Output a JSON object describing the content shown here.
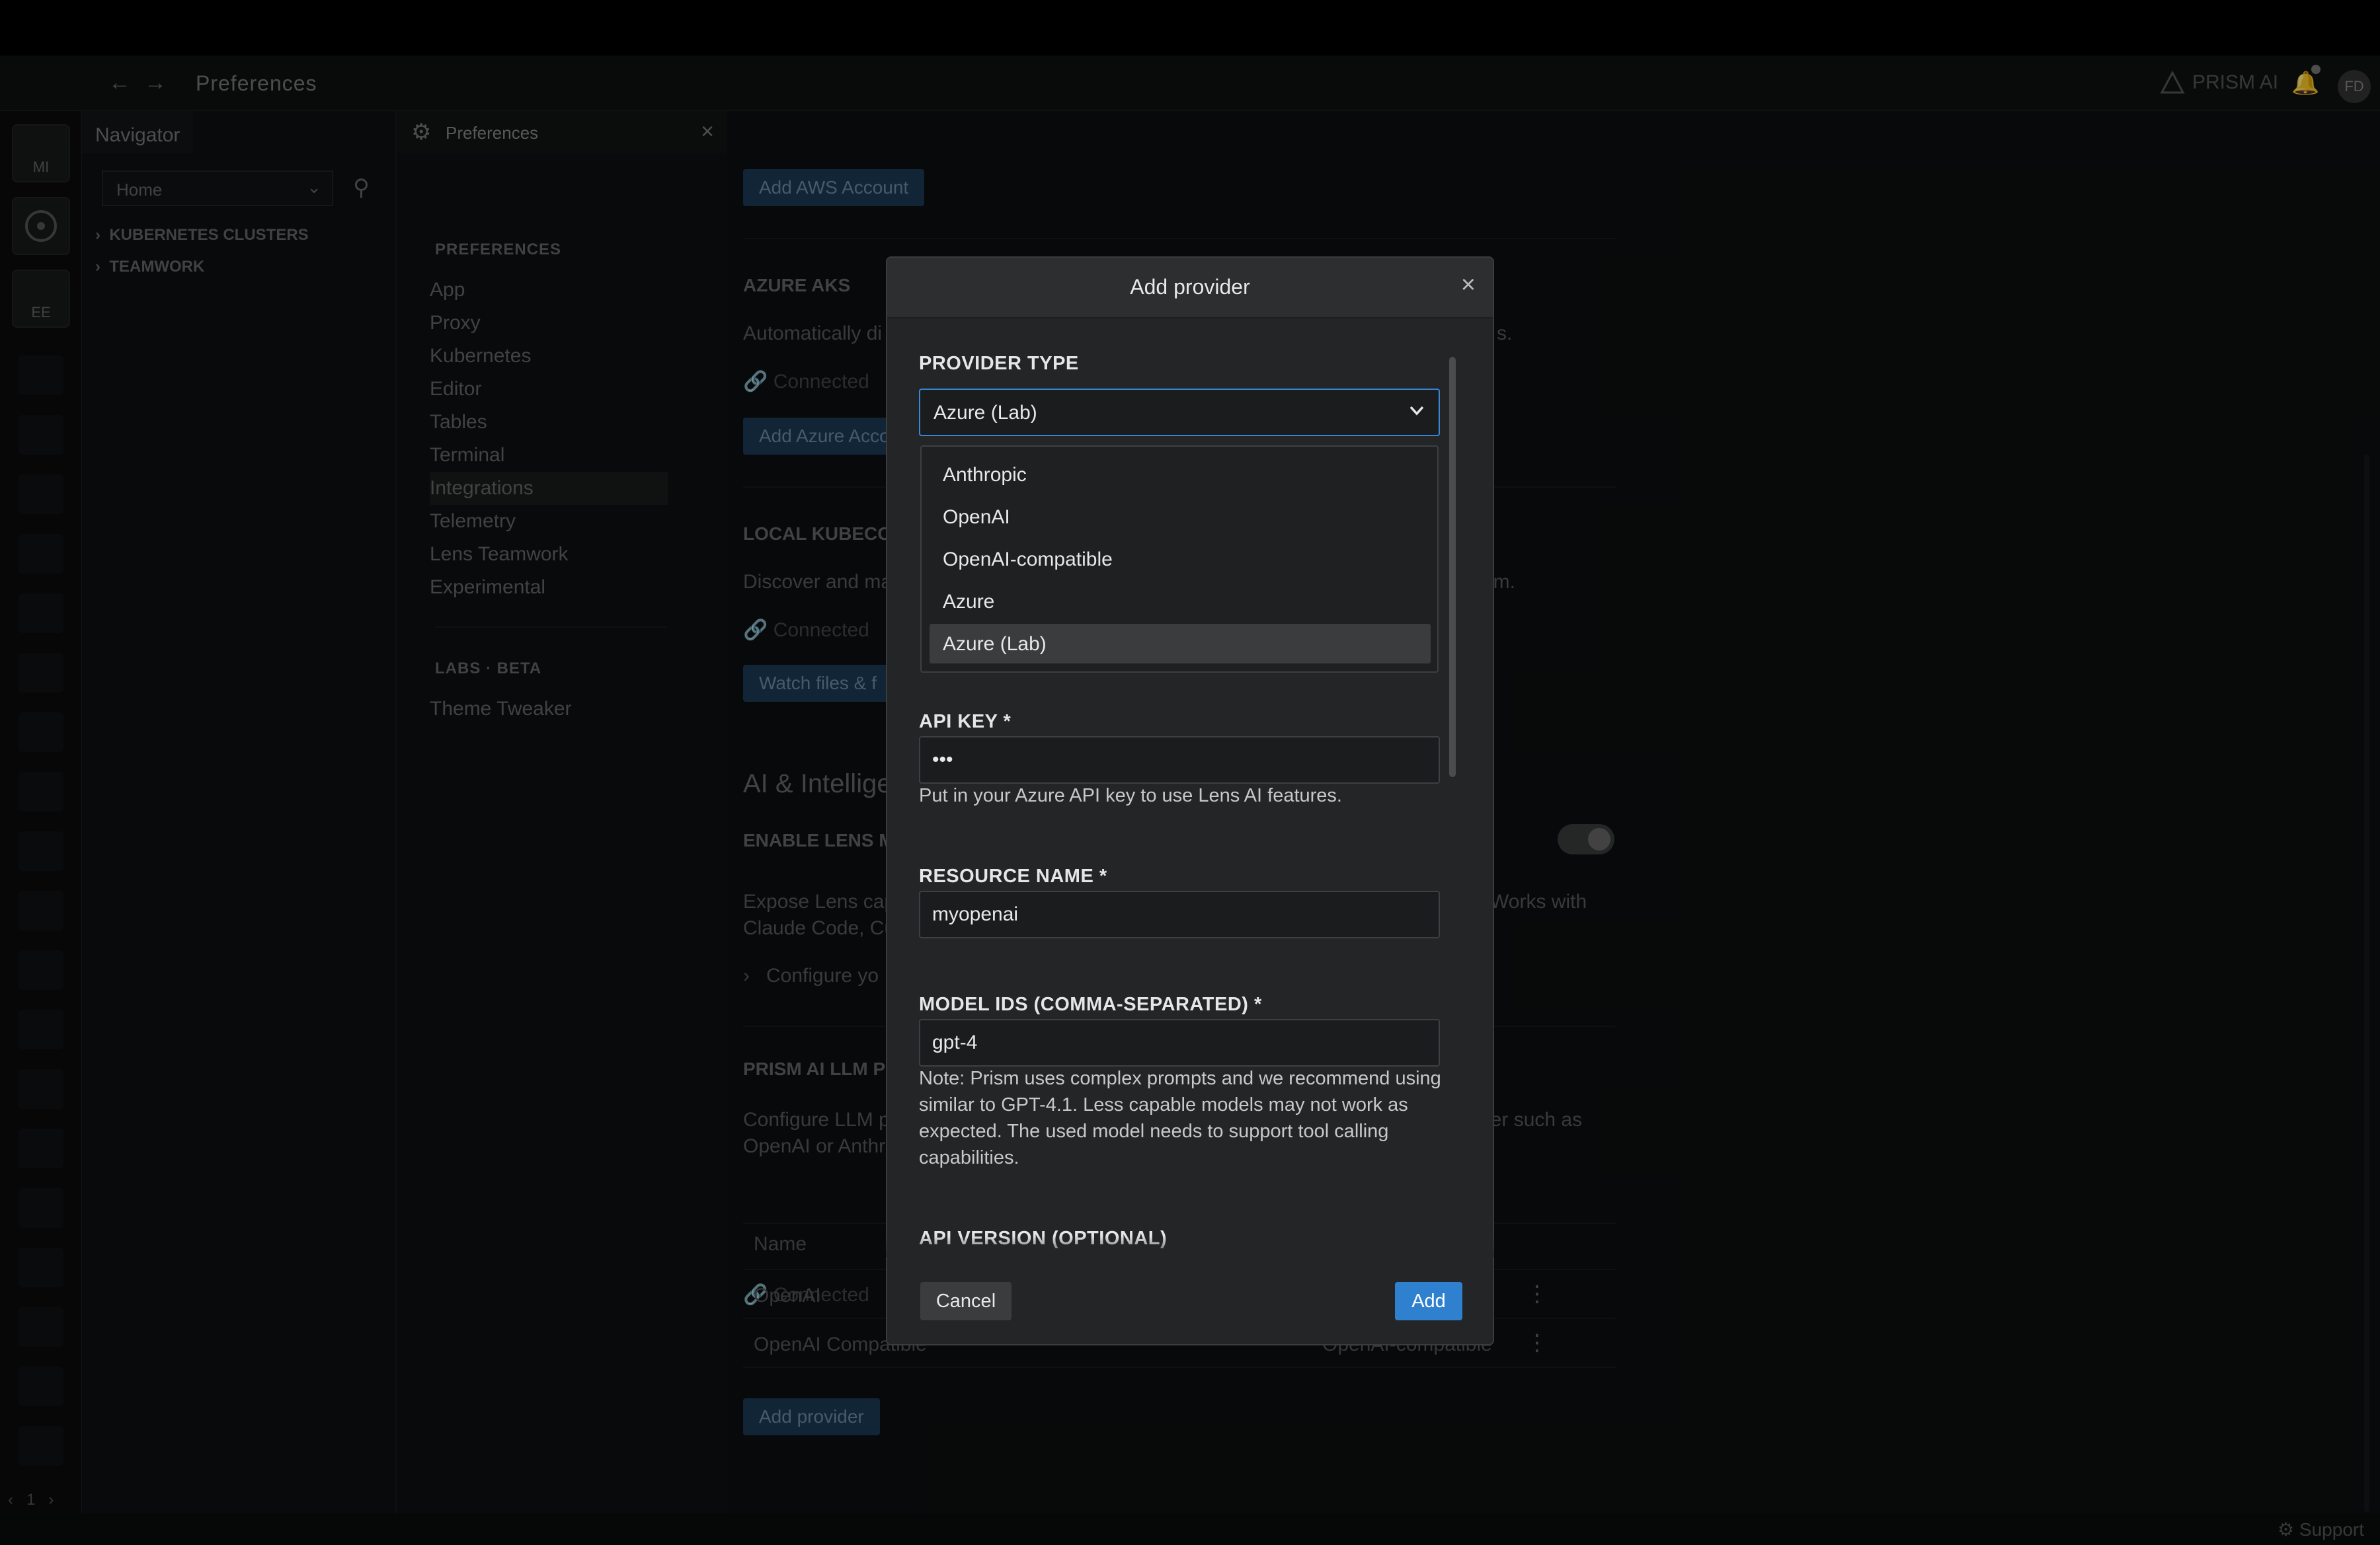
{
  "titlebar": {
    "back_icon": "arrow-left-icon",
    "forward_icon": "arrow-right-icon",
    "title": "Preferences",
    "prism_label": "PRISM AI",
    "avatar": "FD"
  },
  "hotbar": {
    "items": [
      "MI",
      "",
      "EE"
    ],
    "page": "1"
  },
  "navigator": {
    "tab": "Navigator",
    "select_value": "Home",
    "tree": [
      "KUBERNETES CLUSTERS",
      "TEAMWORK"
    ]
  },
  "preferences": {
    "tab": "Preferences",
    "section_heading": "PREFERENCES",
    "items": [
      "App",
      "Proxy",
      "Kubernetes",
      "Editor",
      "Tables",
      "Terminal",
      "Integrations",
      "Telemetry",
      "Lens Teamwork",
      "Experimental"
    ],
    "active_item": "Integrations",
    "labs_heading": "LABS · BETA",
    "labs_items": [
      "Theme Tweaker"
    ]
  },
  "content": {
    "add_aws": "Add AWS Account",
    "azure_heading": "AZURE AKS",
    "azure_text_left": "Automatically di",
    "azure_text_right": "s.",
    "connected": "Connected",
    "add_azure": "Add Azure Acco",
    "local_heading": "LOCAL KUBECON",
    "local_text_left": "Discover and ma",
    "local_text_right": "em.",
    "watch_btn": "Watch files & f",
    "ai_heading": "AI & Intellige",
    "enable_mcp": "ENABLE LENS MC",
    "expose_left_1": "Expose Lens cap",
    "expose_left_2": "Claude Code, Cu",
    "expose_right": "Works with",
    "configure": "Configure yo",
    "prism_heading": "PRISM AI LLM PR",
    "configure_llm_1": "Configure LLM p",
    "configure_llm_2": "OpenAI or Anthr",
    "configure_llm_right": "der such as",
    "table_header_name": "Name",
    "rows": [
      {
        "name": "OpenAI",
        "type": ""
      },
      {
        "name": "OpenAI Compatible",
        "type": "OpenAI-compatible"
      }
    ],
    "add_provider": "Add provider"
  },
  "status": {
    "support": "Support"
  },
  "modal": {
    "title": "Add provider",
    "provider_type_label": "PROVIDER TYPE",
    "provider_type_value": "Azure (Lab)",
    "options": [
      "Anthropic",
      "OpenAI",
      "OpenAI-compatible",
      "Azure",
      "Azure (Lab)"
    ],
    "selected_option": "Azure (Lab)",
    "api_key_label": "API KEY *",
    "api_key_value": "•••",
    "api_key_help": "Put in your Azure API key to use Lens AI features.",
    "resource_label": "RESOURCE NAME *",
    "resource_value": "myopenai",
    "model_ids_label": "MODEL IDS (COMMA-SEPARATED) *",
    "model_ids_value": "gpt-4",
    "model_note": "Note: Prism uses complex prompts and we recommend using similar to GPT-4.1. Less capable models may not work as expected. The used model needs to support tool calling capabilities.",
    "api_version_label": "API VERSION (OPTIONAL)",
    "cancel": "Cancel",
    "add": "Add"
  },
  "colors": {
    "accent": "#2f80cf",
    "modal_bg": "#232526",
    "focus_border": "#3a86d6"
  }
}
